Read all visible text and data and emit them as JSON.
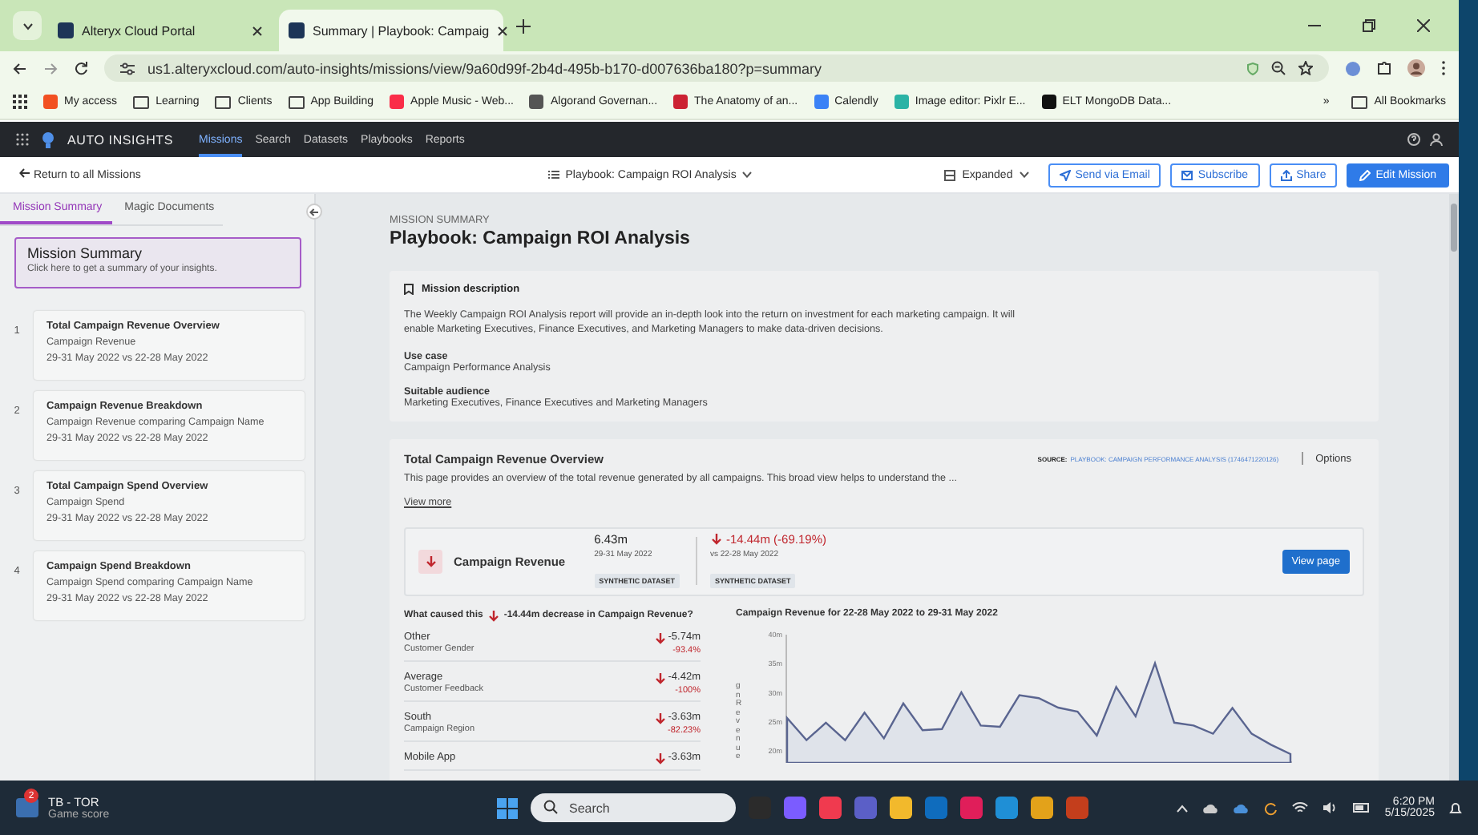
{
  "browser": {
    "tabs": [
      {
        "title": "Alteryx Cloud Portal",
        "selected": false
      },
      {
        "title": "Summary | Playbook: Campaig",
        "selected": true
      }
    ],
    "address": "us1.alteryxcloud.com/auto-insights/missions/view/9a60d99f-2b4d-495b-b170-d007636ba180?p=summary",
    "bookmarks": [
      {
        "label": "My access",
        "kind": "site"
      },
      {
        "label": "Learning",
        "kind": "folder"
      },
      {
        "label": "Clients",
        "kind": "folder"
      },
      {
        "label": "App Building",
        "kind": "folder"
      },
      {
        "label": "Apple Music - Web...",
        "kind": "site"
      },
      {
        "label": "Algorand Governan...",
        "kind": "site"
      },
      {
        "label": "The Anatomy of an...",
        "kind": "site"
      },
      {
        "label": "Calendly",
        "kind": "site"
      },
      {
        "label": "Image editor: Pixlr E...",
        "kind": "site"
      },
      {
        "label": "ELT MongoDB Data...",
        "kind": "site"
      }
    ],
    "more_bookmarks": "»",
    "all_bookmarks": "All Bookmarks"
  },
  "app": {
    "brand": "AUTO INSIGHTS",
    "nav": [
      {
        "label": "Missions",
        "selected": true
      },
      {
        "label": "Search",
        "selected": false
      },
      {
        "label": "Datasets",
        "selected": false
      },
      {
        "label": "Playbooks",
        "selected": false
      },
      {
        "label": "Reports",
        "selected": false
      }
    ]
  },
  "toolbar": {
    "back": "Return to all Missions",
    "playbook": "Playbook: Campaign ROI Analysis",
    "view": "Expanded",
    "buttons": [
      "Send via Email",
      "Subscribe",
      "Share"
    ],
    "primary": "Edit Mission"
  },
  "sidebar": {
    "tabs": [
      {
        "label": "Mission Summary",
        "selected": true
      },
      {
        "label": "Magic Documents",
        "selected": false
      }
    ],
    "summary_card": {
      "title": "Mission Summary",
      "subtitle": "Click here to get a summary of your insights."
    },
    "items": [
      {
        "number": "1",
        "title": "Total Campaign Revenue Overview",
        "metric": "Campaign Revenue",
        "dates": "29-31 May 2022 vs 22-28 May 2022"
      },
      {
        "number": "2",
        "title": "Campaign Revenue Breakdown",
        "metric": "Campaign Revenue comparing Campaign Name",
        "dates": "29-31 May 2022 vs 22-28 May 2022"
      },
      {
        "number": "3",
        "title": "Total Campaign Spend Overview",
        "metric": "Campaign Spend",
        "dates": "29-31 May 2022 vs 22-28 May 2022"
      },
      {
        "number": "4",
        "title": "Campaign Spend Breakdown",
        "metric": "Campaign Spend comparing Campaign Name",
        "dates": "29-31 May 2022 vs 22-28 May 2022"
      }
    ]
  },
  "main": {
    "eyebrow": "MISSION SUMMARY",
    "title": "Playbook: Campaign ROI Analysis",
    "description": {
      "heading": "Mission description",
      "text": "The Weekly Campaign ROI Analysis report will provide an in-depth look into the return on investment for each marketing campaign. It will enable Marketing Executives, Finance Executives, and Marketing Managers to make data-driven decisions.",
      "sections": [
        {
          "label": "Use case",
          "value": "Campaign Performance Analysis"
        },
        {
          "label": "Suitable audience",
          "value": "Marketing Executives, Finance Executives and Marketing Managers"
        }
      ]
    },
    "overview": {
      "title": "Total Campaign Revenue Overview",
      "source_label": "SOURCE:",
      "source": "PLAYBOOK: CAMPAIGN PERFORMANCE ANALYSIS (1746471220126)",
      "options": "Options",
      "text": "This page provides an overview of the total revenue generated by all campaigns. This broad view helps to understand the ...",
      "view_more": "View more",
      "metric": {
        "name": "Campaign Revenue",
        "value": "6.43m",
        "period": "29-31 May 2022",
        "tag": "SYNTHETIC DATASET",
        "change": "-14.44m (-69.19%)",
        "compare": "vs 22-28 May 2022",
        "compare_tag": "SYNTHETIC DATASET",
        "button": "View page"
      },
      "drivers_heading_start": "What caused this",
      "drivers_heading_end": "-14.44m decrease in Campaign Revenue?",
      "drivers": [
        {
          "name": "Other",
          "dimension": "Customer Gender",
          "change": "-5.74m",
          "percent": "-93.4%"
        },
        {
          "name": "Average",
          "dimension": "Customer Feedback",
          "change": "-4.42m",
          "percent": "-100%"
        },
        {
          "name": "South",
          "dimension": "Campaign Region",
          "change": "-3.63m",
          "percent": "-82.23%"
        },
        {
          "name": "Mobile App",
          "change": "-3.63m"
        }
      ],
      "chart_data": {
        "type": "area",
        "title": "Campaign Revenue for 22-28 May 2022 to 29-31 May 2022",
        "ylabel": "gn Revenue",
        "ylim": [
          18,
          40
        ],
        "yticks": [
          {
            "value": 40,
            "label": "40m"
          },
          {
            "value": 35,
            "label": "35m"
          },
          {
            "value": 30,
            "label": "30m"
          },
          {
            "value": 25,
            "label": "25m"
          },
          {
            "value": 20,
            "label": "20m"
          }
        ],
        "categories": [
          null,
          null,
          null,
          null,
          null,
          null,
          null,
          null,
          null,
          null,
          null,
          null,
          null,
          null,
          null,
          null,
          null,
          null,
          null,
          null,
          null,
          null,
          null,
          null,
          null,
          null,
          null
        ],
        "series": [
          {
            "color": "#5a6590",
            "values": [
              25.7,
              21.9,
              24.9,
              21.9,
              26.6,
              22.2,
              28.2,
              23.6,
              23.8,
              30.1,
              24.4,
              24.2,
              29.6,
              29.1,
              27.5,
              26.8,
              22.7,
              31,
              26,
              35.1,
              24.9,
              24.4,
              23,
              27.4,
              23,
              21.1,
              19.5
            ]
          }
        ]
      }
    }
  },
  "taskbar": {
    "notification": {
      "title": "TB - TOR",
      "subtitle": "Game score",
      "badge": "2"
    },
    "search": {
      "placeholder": "Search"
    },
    "time": "6:20 PM",
    "date": "5/15/2025"
  }
}
